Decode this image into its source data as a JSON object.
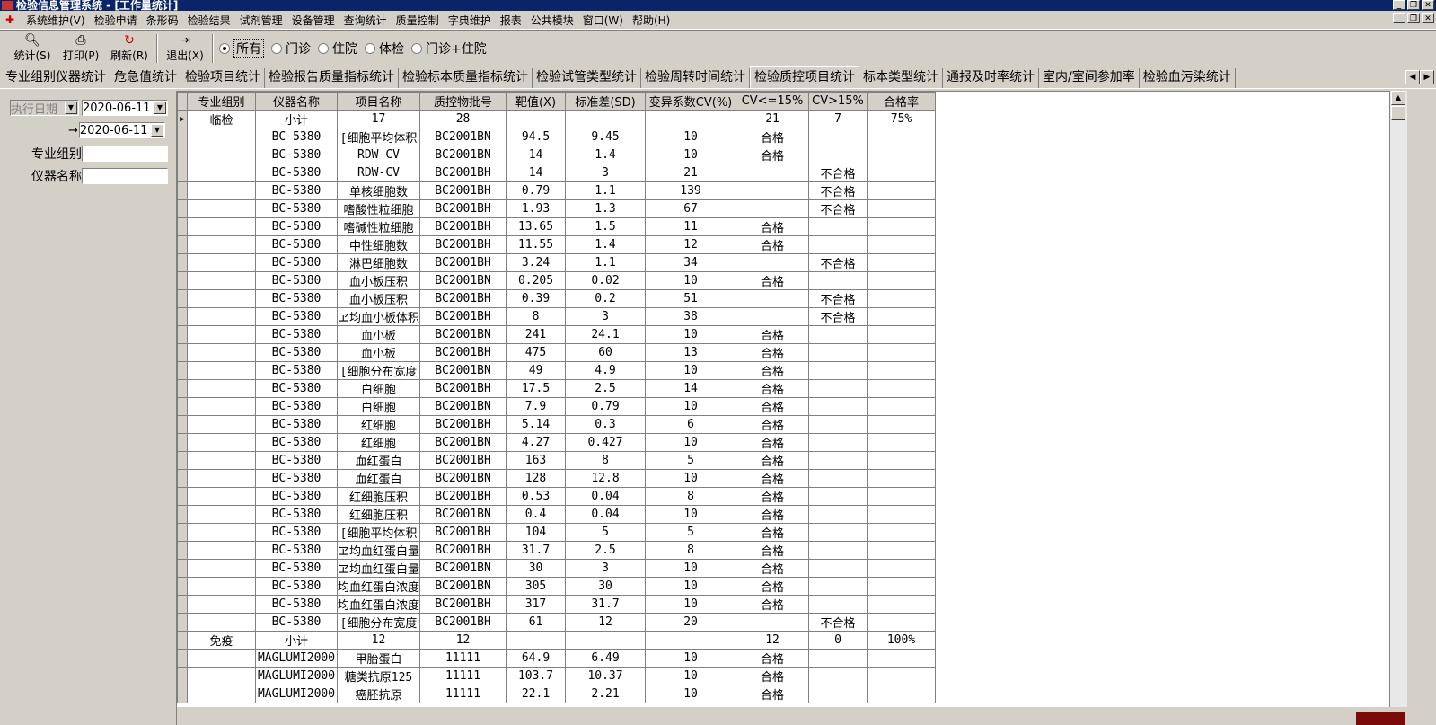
{
  "window": {
    "title": "检验信息管理系统 - [工作量统计]"
  },
  "menu": [
    "系统维护(V)",
    "检验申请",
    "条形码",
    "检验结果",
    "试剂管理",
    "设备管理",
    "查询统计",
    "质量控制",
    "字典维护",
    "报表",
    "公共模块",
    "窗口(W)",
    "帮助(H)"
  ],
  "toolbar": {
    "stat": "统计(S)",
    "print": "打印(P)",
    "refresh": "刷新(R)",
    "exit": "退出(X)",
    "radios": [
      "所有",
      "门诊",
      "住院",
      "体检",
      "门诊+住院"
    ],
    "selected_radio": "所有"
  },
  "tabs": [
    "专业组别仪器统计",
    "危急值统计",
    "检验项目统计",
    "检验报告质量指标统计",
    "检验标本质量指标统计",
    "检验试管类型统计",
    "检验周转时间统计",
    "检验质控项目统计",
    "标本类型统计",
    "通报及时率统计",
    "室内/室间参加率",
    "检验血污染统计"
  ],
  "active_tab": "检验质控项目统计",
  "filters": {
    "date_type": "执行日期",
    "date_from": "2020-06-11",
    "arrow": "→",
    "date_to": "2020-06-11",
    "group_label": "专业组别",
    "group_value": "",
    "instrument_label": "仪器名称",
    "instrument_value": ""
  },
  "table": {
    "columns": [
      "专业组别",
      "仪器名称",
      "项目名称",
      "质控物批号",
      "靶值(X)",
      "标准差(SD)",
      "变异系数CV(%)",
      "CV<=15%",
      "CV>15%",
      "合格率"
    ],
    "rows": [
      [
        "临检",
        "小计",
        "17",
        "28",
        "",
        "",
        "",
        "21",
        "7",
        "75%"
      ],
      [
        "",
        "BC-5380",
        "[细胞平均体积",
        "BC2001BN",
        "94.5",
        "9.45",
        "10",
        "合格",
        "",
        ""
      ],
      [
        "",
        "BC-5380",
        "RDW-CV",
        "BC2001BN",
        "14",
        "1.4",
        "10",
        "合格",
        "",
        ""
      ],
      [
        "",
        "BC-5380",
        "RDW-CV",
        "BC2001BH",
        "14",
        "3",
        "21",
        "",
        "不合格",
        ""
      ],
      [
        "",
        "BC-5380",
        "单核细胞数",
        "BC2001BH",
        "0.79",
        "1.1",
        "139",
        "",
        "不合格",
        ""
      ],
      [
        "",
        "BC-5380",
        "嗜酸性粒细胞",
        "BC2001BH",
        "1.93",
        "1.3",
        "67",
        "",
        "不合格",
        ""
      ],
      [
        "",
        "BC-5380",
        "嗜碱性粒细胞",
        "BC2001BH",
        "13.65",
        "1.5",
        "11",
        "合格",
        "",
        ""
      ],
      [
        "",
        "BC-5380",
        "中性细胞数",
        "BC2001BH",
        "11.55",
        "1.4",
        "12",
        "合格",
        "",
        ""
      ],
      [
        "",
        "BC-5380",
        "淋巴细胞数",
        "BC2001BH",
        "3.24",
        "1.1",
        "34",
        "",
        "不合格",
        ""
      ],
      [
        "",
        "BC-5380",
        "血小板压积",
        "BC2001BN",
        "0.205",
        "0.02",
        "10",
        "合格",
        "",
        ""
      ],
      [
        "",
        "BC-5380",
        "血小板压积",
        "BC2001BH",
        "0.39",
        "0.2",
        "51",
        "",
        "不合格",
        ""
      ],
      [
        "",
        "BC-5380",
        "ヱ均血小板体积",
        "BC2001BH",
        "8",
        "3",
        "38",
        "",
        "不合格",
        ""
      ],
      [
        "",
        "BC-5380",
        "血小板",
        "BC2001BN",
        "241",
        "24.1",
        "10",
        "合格",
        "",
        ""
      ],
      [
        "",
        "BC-5380",
        "血小板",
        "BC2001BH",
        "475",
        "60",
        "13",
        "合格",
        "",
        ""
      ],
      [
        "",
        "BC-5380",
        "[细胞分布宽度",
        "BC2001BN",
        "49",
        "4.9",
        "10",
        "合格",
        "",
        ""
      ],
      [
        "",
        "BC-5380",
        "白细胞",
        "BC2001BH",
        "17.5",
        "2.5",
        "14",
        "合格",
        "",
        ""
      ],
      [
        "",
        "BC-5380",
        "白细胞",
        "BC2001BN",
        "7.9",
        "0.79",
        "10",
        "合格",
        "",
        ""
      ],
      [
        "",
        "BC-5380",
        "红细胞",
        "BC2001BH",
        "5.14",
        "0.3",
        "6",
        "合格",
        "",
        ""
      ],
      [
        "",
        "BC-5380",
        "红细胞",
        "BC2001BN",
        "4.27",
        "0.427",
        "10",
        "合格",
        "",
        ""
      ],
      [
        "",
        "BC-5380",
        "血红蛋白",
        "BC2001BH",
        "163",
        "8",
        "5",
        "合格",
        "",
        ""
      ],
      [
        "",
        "BC-5380",
        "血红蛋白",
        "BC2001BN",
        "128",
        "12.8",
        "10",
        "合格",
        "",
        ""
      ],
      [
        "",
        "BC-5380",
        "红细胞压积",
        "BC2001BH",
        "0.53",
        "0.04",
        "8",
        "合格",
        "",
        ""
      ],
      [
        "",
        "BC-5380",
        "红细胞压积",
        "BC2001BN",
        "0.4",
        "0.04",
        "10",
        "合格",
        "",
        ""
      ],
      [
        "",
        "BC-5380",
        "[细胞平均体积",
        "BC2001BH",
        "104",
        "5",
        "5",
        "合格",
        "",
        ""
      ],
      [
        "",
        "BC-5380",
        "ヱ均血红蛋白量",
        "BC2001BH",
        "31.7",
        "2.5",
        "8",
        "合格",
        "",
        ""
      ],
      [
        "",
        "BC-5380",
        "ヱ均血红蛋白量",
        "BC2001BN",
        "30",
        "3",
        "10",
        "合格",
        "",
        ""
      ],
      [
        "",
        "BC-5380",
        "均血红蛋白浓度",
        "BC2001BN",
        "305",
        "30",
        "10",
        "合格",
        "",
        ""
      ],
      [
        "",
        "BC-5380",
        "均血红蛋白浓度",
        "BC2001BH",
        "317",
        "31.7",
        "10",
        "合格",
        "",
        ""
      ],
      [
        "",
        "BC-5380",
        "[细胞分布宽度",
        "BC2001BH",
        "61",
        "12",
        "20",
        "",
        "不合格",
        ""
      ],
      [
        "免疫",
        "小计",
        "12",
        "12",
        "",
        "",
        "",
        "12",
        "0",
        "100%"
      ],
      [
        "",
        "MAGLUMI2000",
        "甲胎蛋白",
        "11111",
        "64.9",
        "6.49",
        "10",
        "合格",
        "",
        ""
      ],
      [
        "",
        "MAGLUMI2000",
        "糖类抗原125",
        "11111",
        "103.7",
        "10.37",
        "10",
        "合格",
        "",
        ""
      ],
      [
        "",
        "MAGLUMI2000",
        "癌胚抗原",
        "11111",
        "22.1",
        "2.21",
        "10",
        "合格",
        "",
        ""
      ]
    ]
  }
}
